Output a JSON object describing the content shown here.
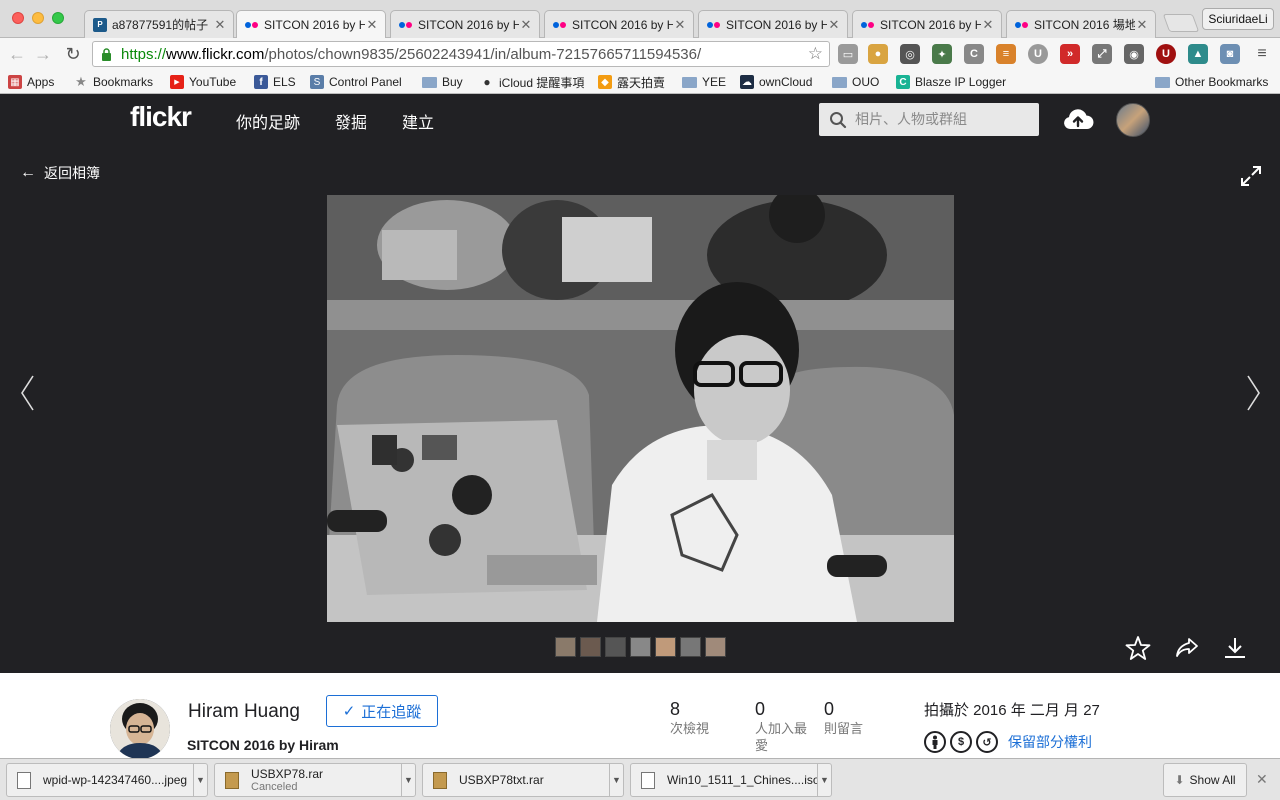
{
  "window": {
    "profile_name": "SciuridaeLi"
  },
  "tabs": [
    {
      "label": "a87877591的帖子",
      "favicon": "ptt-icon",
      "active": false
    },
    {
      "label": "SITCON 2016 by H",
      "favicon": "flickr-icon",
      "active": true
    },
    {
      "label": "SITCON 2016 by H",
      "favicon": "flickr-icon",
      "active": false
    },
    {
      "label": "SITCON 2016 by H",
      "favicon": "flickr-icon",
      "active": false
    },
    {
      "label": "SITCON 2016 by H",
      "favicon": "flickr-icon",
      "active": false
    },
    {
      "label": "SITCON 2016 by H",
      "favicon": "flickr-icon",
      "active": false
    },
    {
      "label": "SITCON 2016 場地",
      "favicon": "flickr-icon",
      "active": false
    }
  ],
  "toolbar": {
    "url_scheme": "https://",
    "url_host": "www.flickr.com",
    "url_path": "/photos/chown9835/25602243941/in/album-72157665711594536/"
  },
  "bookmarks": [
    {
      "label": "Apps",
      "icon": "apps-grid-icon"
    },
    {
      "label": "Bookmarks",
      "icon": "star-icon"
    },
    {
      "label": "YouTube",
      "icon": "youtube-icon"
    },
    {
      "label": "ELS",
      "icon": "facebook-icon"
    },
    {
      "label": "Control Panel",
      "icon": "control-panel-icon"
    },
    {
      "label": "Buy",
      "icon": "folder-icon"
    },
    {
      "label": "iCloud 提醒事項",
      "icon": "apple-icon"
    },
    {
      "label": "露天拍賣",
      "icon": "ruten-icon"
    },
    {
      "label": "YEE",
      "icon": "folder-icon"
    },
    {
      "label": "ownCloud",
      "icon": "owncloud-icon"
    },
    {
      "label": "OUO",
      "icon": "folder-icon"
    },
    {
      "label": "Blasze IP Logger",
      "icon": "blasze-icon"
    },
    {
      "label": "Other Bookmarks",
      "icon": "folder-icon"
    }
  ],
  "flickr": {
    "logo": "flickr",
    "nav": [
      "你的足跡",
      "發掘",
      "建立"
    ],
    "search_placeholder": "相片、人物或群組"
  },
  "photo": {
    "back_label": "返回相簿",
    "thumb_count": 7
  },
  "owner": {
    "name": "Hiram Huang",
    "album": "SITCON 2016 by Hiram",
    "follow_label": "正在追蹤"
  },
  "stats": [
    {
      "value": "8",
      "label": "次檢視"
    },
    {
      "value": "0",
      "label": "人加入最愛"
    },
    {
      "value": "0",
      "label": "則留言"
    }
  ],
  "taken": "拍攝於 2016 年 二月 月 27",
  "license": {
    "label": "保留部分權利",
    "icons": [
      "cc-by-icon",
      "cc-nc-icon",
      "cc-sa-icon"
    ]
  },
  "downloads": [
    {
      "name": "wpid-wp-142347460....jpeg",
      "status": "",
      "type": "image"
    },
    {
      "name": "USBXP78.rar",
      "status": "Canceled",
      "type": "rar"
    },
    {
      "name": "USBXP78txt.rar",
      "status": "",
      "type": "rar"
    },
    {
      "name": "Win10_1511_1_Chines....iso",
      "status": "",
      "type": "file"
    }
  ],
  "download_bar": {
    "show_all": "Show All"
  },
  "colors": {
    "flickr_dark": "#212124",
    "flickr_blue": "#0063dc",
    "flickr_pink": "#ff0084",
    "link_blue": "#1c6fd6"
  }
}
